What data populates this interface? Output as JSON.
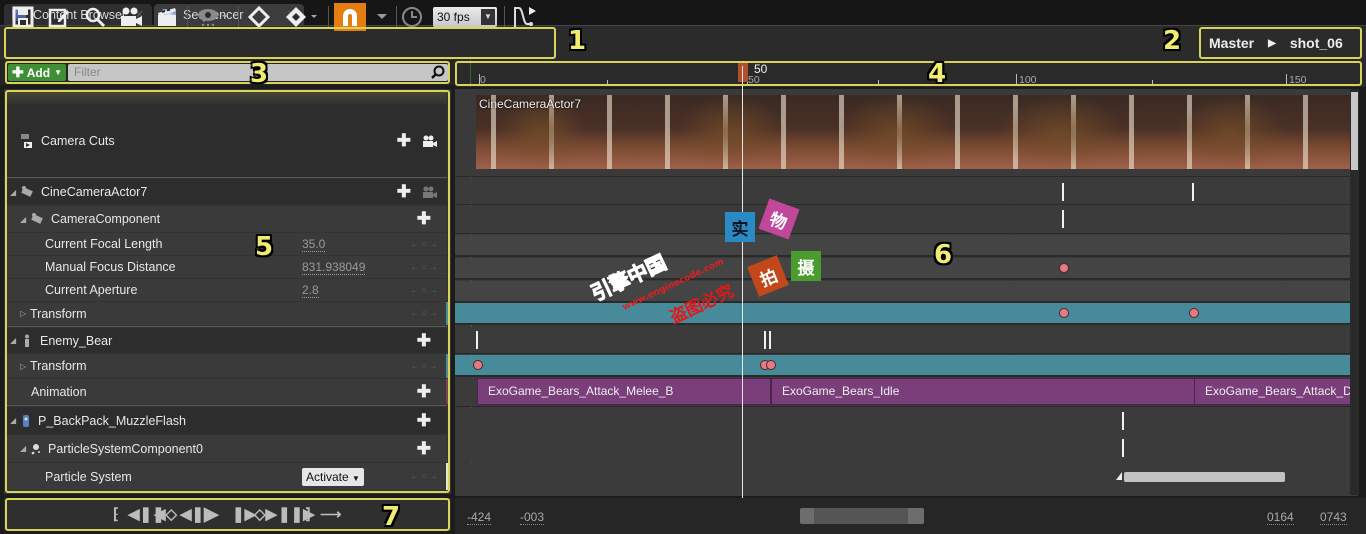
{
  "tabs": [
    {
      "label": "Content Browser",
      "icon": "content-browser-icon",
      "active": false
    },
    {
      "label": "Sequencer",
      "icon": "sequencer-icon",
      "active": true
    }
  ],
  "toolbar": {
    "buttons": [
      "save-icon",
      "save-as-icon",
      "find-icon",
      "camera-icon",
      "clapperboard-icon",
      "eye-visibility-icon",
      "key-diamond-icon",
      "key-all-icon",
      "snap-magnet-icon",
      "clock-icon",
      "curve-editor-icon"
    ],
    "fps": "30 fps",
    "snap_color": "#e57e10"
  },
  "breadcrumb": {
    "root": "Master",
    "separator": "▶",
    "current": "shot_06"
  },
  "callouts": [
    "1",
    "2",
    "3",
    "4",
    "5",
    "6",
    "7"
  ],
  "filter": {
    "add_label": "Add",
    "placeholder": "Filter"
  },
  "tracks": {
    "camera_cuts": "Camera Cuts",
    "cine_camera": "CineCameraActor7",
    "camera_component": "CameraComponent",
    "focal_length": {
      "label": "Current Focal Length",
      "value": "35.0"
    },
    "focus_distance": {
      "label": "Manual Focus Distance",
      "value": "831.938049"
    },
    "aperture": {
      "label": "Current Aperture",
      "value": "2.8"
    },
    "transform1": "Transform",
    "enemy_bear": "Enemy_Bear",
    "transform2": "Transform",
    "animation": "Animation",
    "muzzle": "P_BackPack_MuzzleFlash",
    "particle_component": "ParticleSystemComponent0",
    "particle_system": {
      "label": "Particle System",
      "value": "Activate"
    }
  },
  "keyframe_nav": "←○→",
  "transport": [
    "jump-to-start",
    "step-back-frames",
    "prev-key",
    "step-back",
    "play",
    "step-forward",
    "next-key",
    "step-forward-frames",
    "jump-to-end",
    "loop"
  ],
  "ruler": {
    "ticks": [
      "0",
      "50",
      "100",
      "150"
    ],
    "current_frame": "50"
  },
  "timeline": {
    "shot_label": "CineCameraActor7",
    "clips": [
      "ExoGame_Bears_Attack_Melee_B",
      "ExoGame_Bears_Idle",
      "ExoGame_Bears_Attack_Death"
    ]
  },
  "range": {
    "view_start": "-424",
    "work_start": "-003",
    "work_end": "0164",
    "view_end": "0743"
  },
  "watermark": {
    "chars": [
      "实",
      "物",
      "拍",
      "摄"
    ],
    "site": "引擎中国",
    "url": "www.enginecode.com",
    "warning": "盗图必究"
  }
}
